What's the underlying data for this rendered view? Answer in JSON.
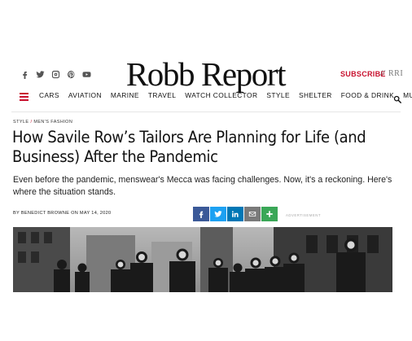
{
  "header": {
    "logo_text": "Robb Report",
    "subscribe_label": "SUBSCRIBE",
    "separator": "//",
    "rri_label": "RRI",
    "social": [
      "facebook-icon",
      "twitter-icon",
      "instagram-icon",
      "pinterest-icon",
      "youtube-icon"
    ]
  },
  "nav": {
    "items": [
      {
        "label": "CARS"
      },
      {
        "label": "AVIATION"
      },
      {
        "label": "MARINE"
      },
      {
        "label": "TRAVEL"
      },
      {
        "label": "WATCH COLLECTOR"
      },
      {
        "label": "STYLE"
      },
      {
        "label": "SHELTER"
      },
      {
        "label": "FOOD & DRINK"
      },
      {
        "label": "MUSE"
      }
    ]
  },
  "article": {
    "breadcrumb": {
      "section": "STYLE",
      "separator": "/",
      "subsection": "MEN'S FASHION"
    },
    "headline": "How Savile Row’s Tailors Are Planning for Life (and Business) After the Pandemic",
    "dek": "Even before the pandemic, menswear's Mecca was facing challenges. Now, it's a reckoning. Here's where the situation stands.",
    "byline": "BY BENEDICT BROWNE ON MAY 14, 2020",
    "ad_label": "ADVERTISEMENT"
  },
  "colors": {
    "accent": "#c8102e",
    "facebook": "#3b5998",
    "twitter": "#1da1f2",
    "linkedin": "#0077b5",
    "email": "#7a7a7a",
    "more": "#3aa757"
  },
  "share_icons": [
    "facebook-share-icon",
    "twitter-share-icon",
    "linkedin-share-icon",
    "email-share-icon",
    "plus-share-icon"
  ]
}
